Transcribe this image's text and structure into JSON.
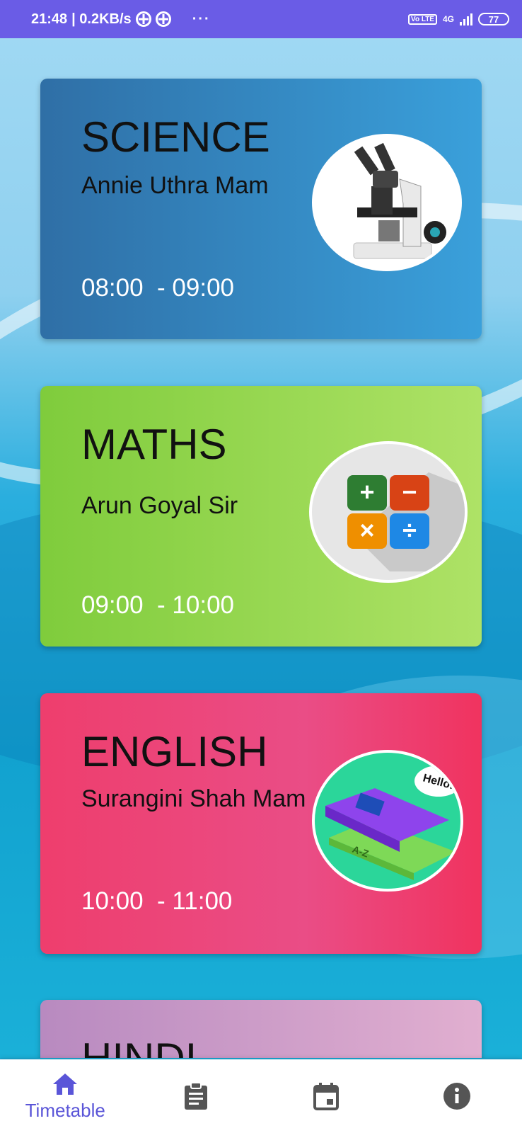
{
  "status_bar": {
    "time": "21:48",
    "speed": "| 0.2KB/s",
    "dots": "···",
    "network": "4G",
    "volte": "Vo LTE",
    "battery": "77"
  },
  "cards": [
    {
      "subject": "SCIENCE",
      "teacher": "Annie Uthra Mam",
      "time": "08:00  - 09:00",
      "icon": "microscope-icon"
    },
    {
      "subject": "MATHS",
      "teacher": "Arun Goyal Sir",
      "time": "09:00  - 10:00",
      "icon": "calculator-icon",
      "symbols": [
        "+",
        "−",
        "×",
        "÷"
      ]
    },
    {
      "subject": "ENGLISH",
      "teacher": "Surangini Shah Mam",
      "time": "10:00  - 11:00",
      "icon": "books-icon",
      "bubble": "Hello!",
      "book_text": "A-Z"
    },
    {
      "subject": "HINDI"
    }
  ],
  "nav": {
    "items": [
      {
        "label": "Timetable",
        "icon": "home-icon",
        "active": true
      },
      {
        "icon": "clipboard-icon"
      },
      {
        "icon": "calendar-icon"
      },
      {
        "icon": "info-icon"
      }
    ]
  }
}
